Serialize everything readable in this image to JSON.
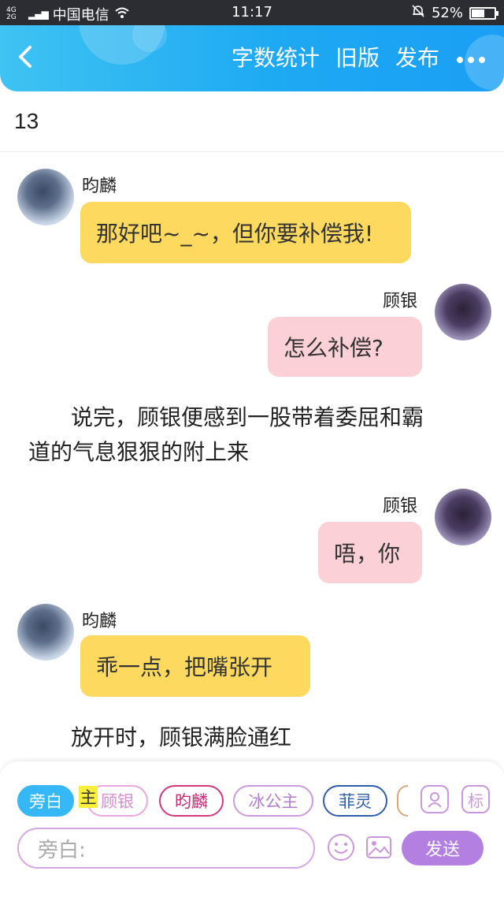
{
  "status_bar": {
    "network": "4G 2G",
    "carrier": "中国电信",
    "time": "11:17",
    "battery": "52%",
    "battery_level": 0.52
  },
  "header": {
    "back_icon": "chevron-left-icon",
    "actions": [
      "字数统计",
      "旧版",
      "发布"
    ],
    "more_icon": "more-dots-icon"
  },
  "word_count": "13",
  "messages": [
    {
      "type": "bubble",
      "side": "left",
      "speaker": "昀麟",
      "text": "那好吧~_~，但你要补偿我!",
      "color": "#fdd95f"
    },
    {
      "type": "bubble",
      "side": "right",
      "speaker": "顾银",
      "text": "怎么补偿?",
      "color": "#fbd0d6"
    },
    {
      "type": "narration",
      "line1": "说完，顾银便感到一股带着委屈和霸",
      "line2": "道的气息狠狠的附上来"
    },
    {
      "type": "bubble",
      "side": "right",
      "speaker": "顾银",
      "text": "唔，你",
      "color": "#fbd0d6"
    },
    {
      "type": "bubble",
      "side": "left",
      "speaker": "昀麟",
      "text": "乖一点，把嘴张开",
      "color": "#fdd95f"
    },
    {
      "type": "narration",
      "line1": "放开时，顾银满脸通红"
    }
  ],
  "roles": [
    {
      "label": "旁白",
      "color": "#35b8f5",
      "active": true
    },
    {
      "label": "顾银",
      "color": "#e9a7e0",
      "active": false
    },
    {
      "label": "昀麟",
      "color": "#d2387e",
      "active": false
    },
    {
      "label": "冰公主",
      "color": "#c99bdc",
      "active": false
    },
    {
      "label": "菲灵",
      "color": "#2f5ea8",
      "active": false
    }
  ],
  "role_highlight": "主",
  "icons": {
    "character": "character-icon",
    "tag": "标"
  },
  "input": {
    "placeholder": "旁白:"
  },
  "send_label": "发送"
}
